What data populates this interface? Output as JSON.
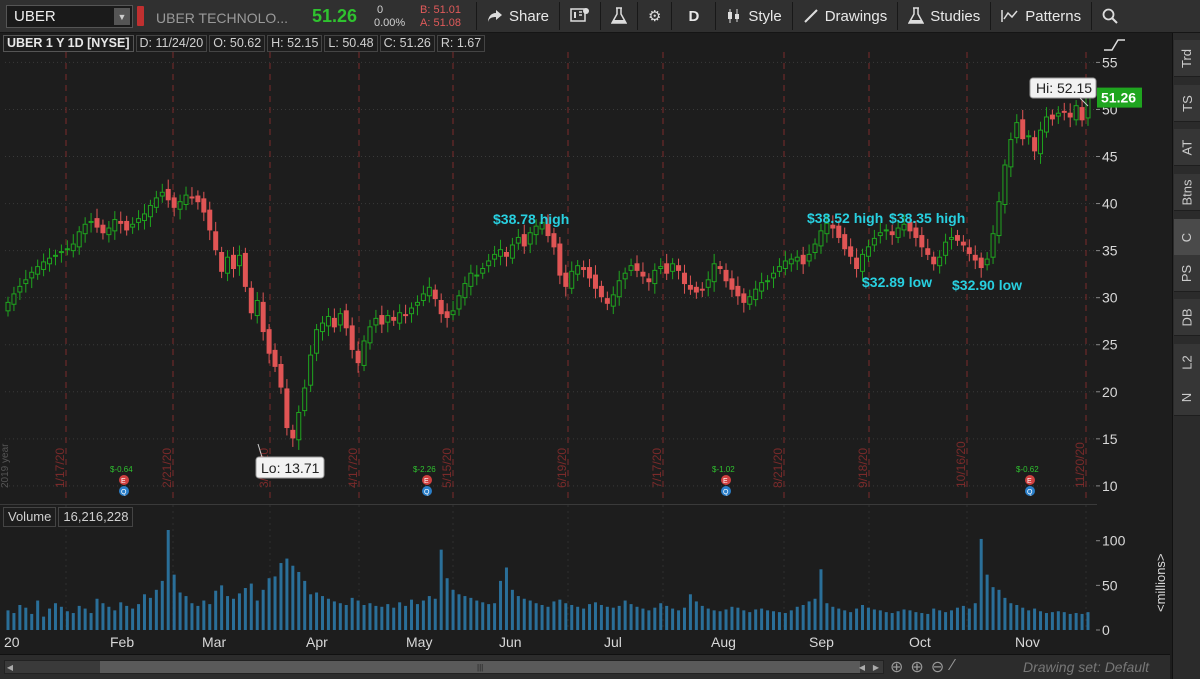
{
  "toolbar": {
    "symbol": "UBER",
    "company": "UBER TECHNOLO...",
    "last": "51.26",
    "change": "0",
    "change_pct": "0.00%",
    "bid": "B: 51.01",
    "ask": "A: 51.08",
    "share": "Share",
    "timeframe": "D",
    "style": "Style",
    "drawings": "Drawings",
    "studies": "Studies",
    "patterns": "Patterns"
  },
  "side_tabs": [
    "Trd",
    "TS",
    "AT",
    "Btns",
    "C",
    "PS",
    "DB",
    "L2",
    "N"
  ],
  "info": {
    "title": "UBER 1 Y 1D [NYSE]",
    "date": "D: 11/24/20",
    "open": "O: 50.62",
    "high": "H: 52.15",
    "low": "L: 50.48",
    "close": "C: 51.26",
    "range": "R: 1.67"
  },
  "volume_header": {
    "label": "Volume",
    "value": "16,216,228"
  },
  "bottom": {
    "drawing_set": "Drawing set: Default"
  },
  "chart_data": {
    "type": "candlestick",
    "symbol": "UBER",
    "y_ticks": [
      10,
      15,
      20,
      25,
      30,
      35,
      40,
      45,
      50,
      55
    ],
    "ylim": [
      8.5,
      56
    ],
    "vol_ticks": [
      0,
      50,
      100
    ],
    "vol_ylim": [
      0,
      112
    ],
    "vol_axis_label": "<millions>",
    "month_labels": [
      "20",
      "Feb",
      "Mar",
      "Apr",
      "May",
      "Jun",
      "Jul",
      "Aug",
      "Sep",
      "Oct",
      "Nov"
    ],
    "vertical_date_labels": [
      "1/17/20",
      "2/21/20",
      "3/20/20",
      "4/17/20",
      "5/15/20",
      "6/19/20",
      "7/17/20",
      "8/21/20",
      "9/18/20",
      "10/16/20",
      "11/20/20"
    ],
    "earnings_markers": [
      {
        "date": "2/6/20",
        "label": "$-0.64"
      },
      {
        "date": "5/7/20",
        "label": "$-2.26"
      },
      {
        "date": "8/6/20",
        "label": "$-1.02"
      },
      {
        "date": "11/5/20",
        "label": "$-0.62"
      }
    ],
    "price_marker": {
      "value": 51.26,
      "label": "51.26",
      "color": "#1fa51f"
    },
    "annotations": [
      {
        "text": "$38.78 high",
        "date": "6/1/20",
        "price": 38.78
      },
      {
        "text": "$38.52 high",
        "date": "9/14/20",
        "price": 38.52
      },
      {
        "text": "$38.35 high",
        "date": "10/6/20",
        "price": 38.35
      },
      {
        "text": "$32.89 low",
        "date": "9/23/20",
        "price": 32.89
      },
      {
        "text": "$32.90 low",
        "date": "10/21/20",
        "price": 32.9
      }
    ],
    "callouts": [
      {
        "text": "Hi: 52.15",
        "date": "11/24/20",
        "price": 52.15
      },
      {
        "text": "Lo: 13.71",
        "date": "3/18/20",
        "price": 13.71
      }
    ],
    "volume_spikes_millions": [
      {
        "date": "2/7/20",
        "value": 112
      },
      {
        "date": "3/19/20",
        "value": 80
      },
      {
        "date": "5/8/20",
        "value": 90
      },
      {
        "date": "6/1/20",
        "value": 70
      },
      {
        "date": "9/15/20",
        "value": 68
      },
      {
        "date": "11/6/20",
        "value": 102
      },
      {
        "date": "11/9/20",
        "value": 62
      }
    ],
    "closes": [
      29.5,
      30.4,
      31.2,
      31.9,
      32.7,
      33.3,
      33.8,
      34.2,
      34.5,
      34.9,
      35.2,
      35.7,
      37.0,
      37.8,
      38.1,
      37.5,
      36.9,
      37.4,
      38.3,
      37.9,
      37.2,
      37.8,
      38.4,
      38.9,
      39.8,
      40.6,
      41.2,
      40.4,
      39.6,
      40.2,
      40.9,
      40.6,
      40.2,
      39.1,
      37.2,
      35.1,
      32.8,
      34.3,
      33.1,
      34.5,
      31.2,
      28.4,
      29.7,
      26.4,
      24.1,
      22.7,
      20.5,
      16.2,
      15.1,
      17.8,
      20.4,
      23.9,
      26.6,
      27.3,
      28.0,
      26.9,
      28.3,
      26.8,
      24.5,
      23.1,
      25.4,
      26.9,
      27.8,
      27.2,
      28.1,
      27.6,
      28.4,
      28.1,
      28.9,
      29.5,
      30.4,
      31.1,
      29.9,
      28.3,
      27.9,
      28.6,
      30.2,
      31.5,
      32.6,
      32.4,
      33.1,
      33.9,
      34.6,
      35.1,
      34.4,
      35.6,
      36.4,
      35.5,
      36.9,
      37.6,
      38.0,
      36.6,
      35.4,
      32.4,
      31.2,
      32.8,
      33.4,
      33.0,
      32.1,
      31.0,
      30.1,
      29.4,
      30.3,
      31.8,
      32.6,
      33.4,
      32.9,
      32.3,
      31.7,
      32.9,
      33.3,
      32.6,
      33.6,
      32.9,
      31.5,
      30.9,
      30.6,
      30.9,
      31.9,
      33.6,
      33.1,
      31.8,
      30.9,
      30.2,
      29.5,
      30.1,
      30.9,
      31.6,
      31.8,
      32.6,
      33.3,
      33.9,
      34.1,
      34.3,
      33.6,
      34.6,
      35.7,
      37.1,
      37.9,
      37.4,
      36.4,
      35.2,
      34.4,
      33.1,
      34.6,
      35.4,
      36.3,
      36.9,
      37.2,
      36.7,
      37.4,
      37.8,
      37.1,
      36.4,
      35.4,
      34.6,
      33.6,
      34.3,
      35.9,
      36.4,
      36.1,
      35.6,
      34.7,
      34.0,
      33.2,
      34.1,
      36.8,
      40.2,
      44.1,
      46.8,
      48.6,
      46.9,
      47.2,
      45.6,
      47.8,
      49.2,
      49.0,
      49.6,
      49.8,
      49.2,
      50.4,
      48.9,
      51.26
    ],
    "volumes_millions": [
      22,
      19,
      28,
      25,
      18,
      33,
      15,
      24,
      30,
      26,
      21,
      19,
      27,
      24,
      19,
      35,
      30,
      26,
      22,
      31,
      27,
      24,
      29,
      40,
      36,
      45,
      55,
      112,
      62,
      42,
      38,
      30,
      27,
      33,
      29,
      44,
      50,
      38,
      35,
      41,
      47,
      52,
      33,
      45,
      58,
      60,
      75,
      80,
      72,
      65,
      55,
      40,
      42,
      38,
      35,
      32,
      30,
      28,
      36,
      33,
      28,
      30,
      27,
      26,
      29,
      25,
      31,
      27,
      34,
      29,
      33,
      38,
      35,
      90,
      58,
      45,
      40,
      38,
      36,
      33,
      31,
      29,
      30,
      55,
      70,
      45,
      38,
      35,
      33,
      30,
      28,
      26,
      32,
      34,
      30,
      28,
      26,
      24,
      29,
      31,
      28,
      26,
      25,
      27,
      33,
      29,
      26,
      24,
      22,
      25,
      30,
      27,
      24,
      22,
      25,
      40,
      32,
      27,
      24,
      22,
      21,
      23,
      26,
      25,
      22,
      20,
      23,
      24,
      22,
      21,
      20,
      19,
      22,
      26,
      28,
      32,
      35,
      68,
      30,
      26,
      24,
      22,
      20,
      24,
      28,
      25,
      23,
      22,
      20,
      19,
      21,
      23,
      22,
      20,
      19,
      18,
      24,
      22,
      20,
      22,
      25,
      27,
      24,
      30,
      102,
      62,
      48,
      45,
      36,
      30,
      28,
      25,
      22,
      24,
      21,
      19,
      20,
      21,
      20,
      18,
      19,
      18,
      20
    ]
  }
}
